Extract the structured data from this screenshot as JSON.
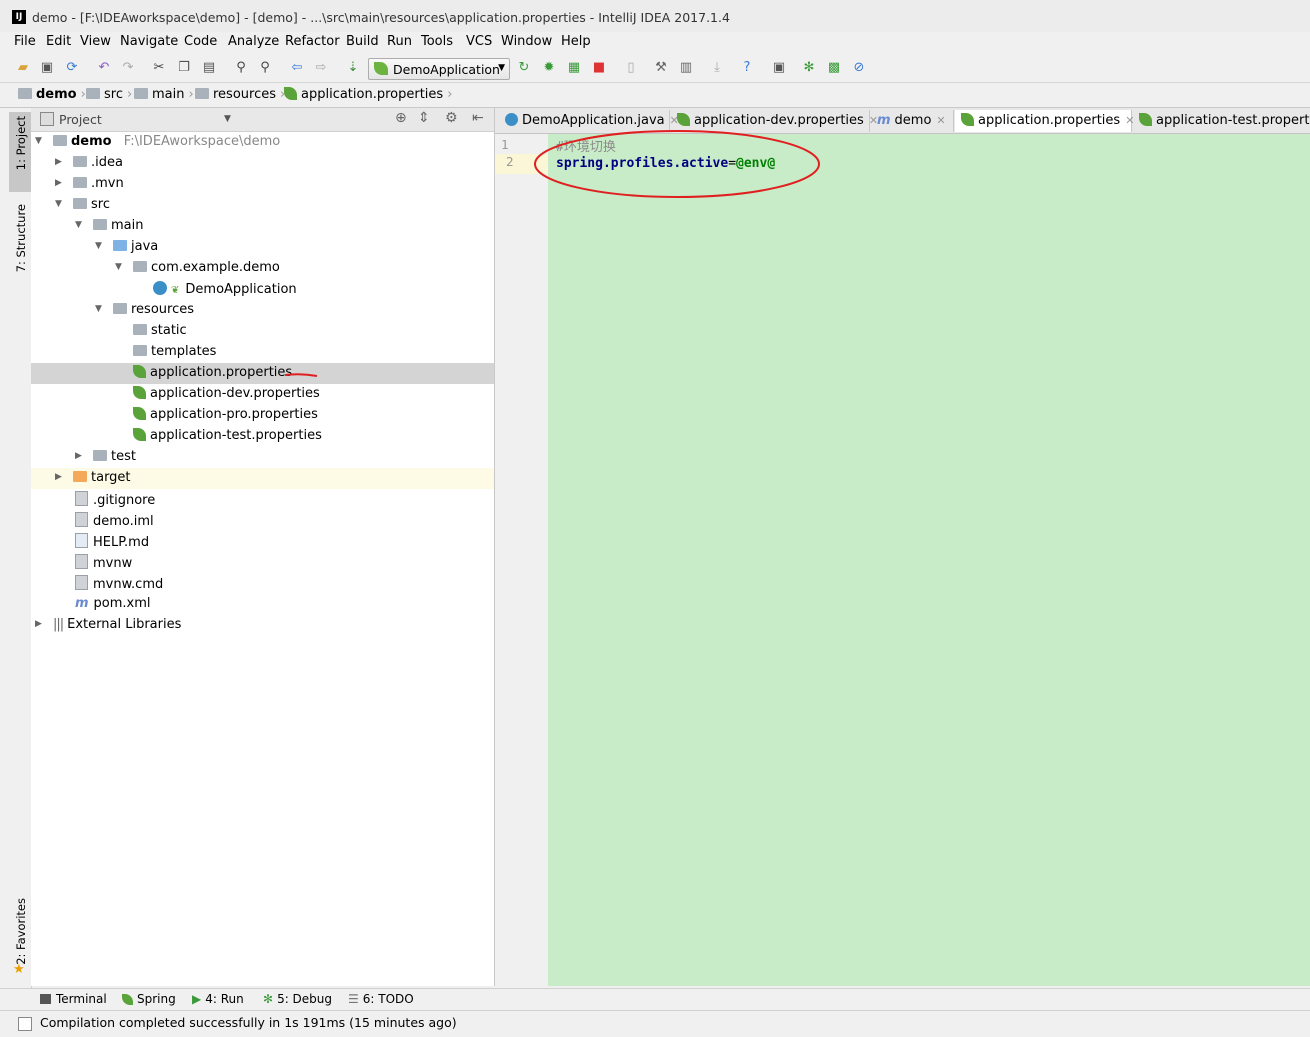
{
  "window": {
    "title": "demo - [F:\\IDEAworkspace\\demo] - [demo] - ...\\src\\main\\resources\\application.properties - IntelliJ IDEA 2017.1.4",
    "app_icon_text": "IJ"
  },
  "menu": [
    "File",
    "Edit",
    "View",
    "Navigate",
    "Code",
    "Analyze",
    "Refactor",
    "Build",
    "Run",
    "Tools",
    "VCS",
    "Window",
    "Help"
  ],
  "toolbar": {
    "run_config": "DemoApplication"
  },
  "breadcrumb": [
    "demo",
    "src",
    "main",
    "resources",
    "application.properties"
  ],
  "left_strip": {
    "project_tab": "1: Project",
    "structure_tab": "7: Structure",
    "favorites_tab": "2: Favorites"
  },
  "project_panel": {
    "header": "Project",
    "tree": [
      {
        "label": "demo",
        "suffix": "F:\\IDEAworkspace\\demo"
      },
      {
        "label": ".idea"
      },
      {
        "label": ".mvn"
      },
      {
        "label": "src"
      },
      {
        "label": "main"
      },
      {
        "label": "java"
      },
      {
        "label": "com.example.demo"
      },
      {
        "label": "DemoApplication"
      },
      {
        "label": "resources"
      },
      {
        "label": "static"
      },
      {
        "label": "templates"
      },
      {
        "label": "application.properties"
      },
      {
        "label": "application-dev.properties"
      },
      {
        "label": "application-pro.properties"
      },
      {
        "label": "application-test.properties"
      },
      {
        "label": "test"
      },
      {
        "label": "target"
      },
      {
        "label": ".gitignore"
      },
      {
        "label": "demo.iml"
      },
      {
        "label": "HELP.md"
      },
      {
        "label": "mvnw"
      },
      {
        "label": "mvnw.cmd"
      },
      {
        "label": "pom.xml"
      },
      {
        "label": "External Libraries"
      }
    ]
  },
  "editor_tabs": [
    "DemoApplication.java",
    "application-dev.properties",
    "demo",
    "application.properties",
    "application-test.properties"
  ],
  "editor": {
    "lines": [
      {
        "num": "1",
        "text": "#环境切换"
      },
      {
        "num": "2",
        "key": "spring.profiles.active",
        "eq": "=",
        "value": "@env@"
      }
    ]
  },
  "bottom_tools": [
    "Terminal",
    "Spring",
    "4: Run",
    "5: Debug",
    "6: TODO"
  ],
  "status": "Compilation completed successfully in 1s 191ms (15 minutes ago)",
  "colors": {
    "editor_bg": "#c8ebc8",
    "selected_row": "#d4d4d4",
    "annotation": "#e02020"
  }
}
